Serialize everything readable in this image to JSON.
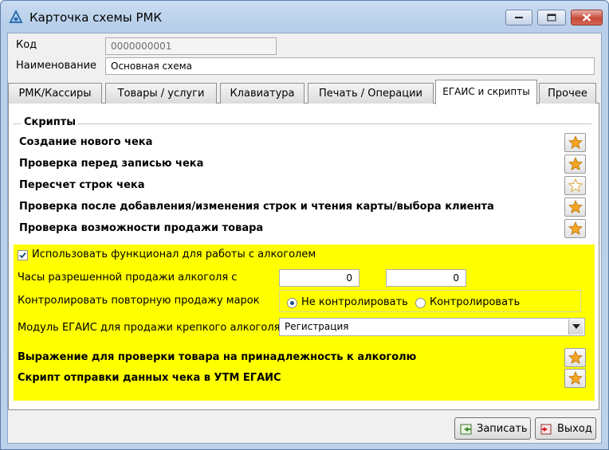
{
  "window": {
    "title": "Карточка схемы РМК",
    "icon": "app-icon"
  },
  "header": {
    "code_label": "Код",
    "code_value": "0000000001",
    "name_label": "Наименование",
    "name_value": "Основная схема"
  },
  "tabs": [
    {
      "label": "РМК/Кассиры"
    },
    {
      "label": "Товары / услуги"
    },
    {
      "label": "Клавиатура"
    },
    {
      "label": "Печать / Операции"
    },
    {
      "label": "ЕГАИС и скрипты",
      "active": true
    },
    {
      "label": "Прочее"
    }
  ],
  "scripts": {
    "legend": "Скрипты",
    "items": [
      {
        "label": "Создание нового чека",
        "filled": true
      },
      {
        "label": "Проверка перед записью чека",
        "filled": true
      },
      {
        "label": "Пересчет строк чека",
        "filled": false
      },
      {
        "label": "Проверка после добавления/изменения строк и чтения карты/выбора клиента",
        "filled": true
      },
      {
        "label": "Проверка возможности продажи товара",
        "filled": true
      }
    ]
  },
  "alcohol": {
    "use_label": "Использовать функционал для работы с алкоголем",
    "use_checked": true,
    "hours_label": "Часы разрешенной продажи алкоголя с",
    "hours_from": "0",
    "hours_to": "0",
    "control_label": "Контролировать повторную продажу марок",
    "control_options": [
      {
        "label": "Не контролировать",
        "selected": true
      },
      {
        "label": "Контролировать",
        "selected": false
      }
    ],
    "module_label": "Модуль ЕГАИС для продажи крепкого алкоголя",
    "module_value": "Регистрация",
    "expr_label": "Выражение для проверки товара на принадлежность к алкоголю",
    "send_label": "Скрипт отправки данных чека в УТМ ЕГАИС"
  },
  "footer": {
    "save_label": "Записать",
    "exit_label": "Выход"
  },
  "colors": {
    "highlight": "#ffff00",
    "star_fill": "#f5a623",
    "title_bar": "#c9dcf2"
  }
}
